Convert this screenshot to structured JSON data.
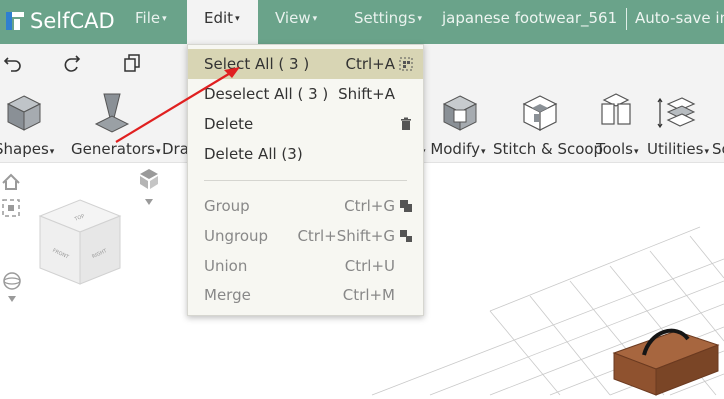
{
  "app": {
    "logo_text": "SelfCAD"
  },
  "menubar": {
    "items": [
      {
        "label": "File",
        "caret": "▾"
      },
      {
        "label": "Edit",
        "caret": "▾"
      },
      {
        "label": "View",
        "caret": "▾"
      },
      {
        "label": "Settings",
        "caret": "▾"
      }
    ],
    "project_name": "japanese footwear_561",
    "autosave": "Auto-save in"
  },
  "quick_actions": [
    "undo-icon",
    "redo-icon",
    "copy-icon"
  ],
  "tools": [
    {
      "label": "Shapes",
      "icon": "cube-icon"
    },
    {
      "label": "Generators",
      "icon": "generator-icon"
    },
    {
      "label": "Dra",
      "icon": "draw-icon"
    },
    {
      "label": "Modify",
      "icon": "modify-icon"
    },
    {
      "label": "Stitch & Scoop",
      "icon": "stitch-scoop-icon"
    },
    {
      "label": "Tools",
      "icon": "tools-icon"
    },
    {
      "label": "Utilities",
      "icon": "utilities-icon"
    },
    {
      "label": "Sc",
      "icon": "sculpt-icon"
    }
  ],
  "edit_menu": {
    "items": [
      {
        "label": "Select All   ( 3 )",
        "shortcut": "Ctrl+A",
        "highlighted": true
      },
      {
        "label": "Deselect All   ( 3 )",
        "shortcut": "Shift+A"
      },
      {
        "label": "Delete",
        "shortcut": ""
      },
      {
        "label": "Delete All (3)",
        "shortcut": ""
      },
      {
        "label": "Group",
        "shortcut": "Ctrl+G",
        "disabled": true
      },
      {
        "label": "Ungroup",
        "shortcut": "Ctrl+Shift+G",
        "disabled": true
      },
      {
        "label": "Union",
        "shortcut": "Ctrl+U",
        "disabled": true
      },
      {
        "label": "Merge",
        "shortcut": "Ctrl+M",
        "disabled": true
      }
    ]
  },
  "viewcube": {
    "faces": [
      "TOP",
      "FRONT",
      "RIGHT"
    ]
  },
  "colors": {
    "topbar": "#6aa38a",
    "highlight": "#d8d5b4",
    "arrow": "#e02020",
    "object": "#9c5a36"
  }
}
